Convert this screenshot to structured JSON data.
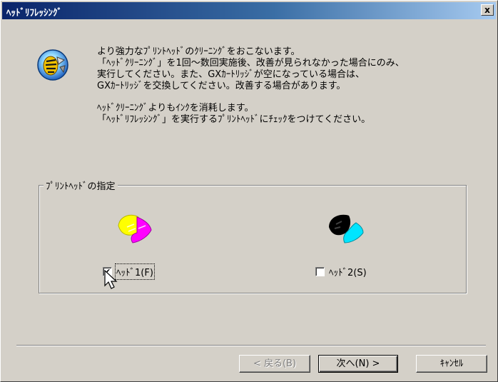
{
  "window": {
    "title": "ﾍｯﾄﾞﾘﾌﾚｯｼﾝｸﾞ",
    "close_glyph": "x",
    "icon": "printer-head-cleaning-icon"
  },
  "message": {
    "line1": "より強力なﾌﾟﾘﾝﾄﾍｯﾄﾞのｸﾘｰﾆﾝｸﾞをおこないます。",
    "line2": "「ﾍｯﾄﾞｸﾘｰﾆﾝｸﾞ」を1回～数回実施後、改善が見られなかった場合にのみ、",
    "line3": "実行してください。また、GXｶｰﾄﾘｯｼﾞが空になっている場合は、",
    "line4": "GXｶｰﾄﾘｯｼﾞを交換してください。改善する場合があります。",
    "line5": "ﾍｯﾄﾞｸﾘｰﾆﾝｸﾞよりもｲﾝｸを消耗します。",
    "line6": "「ﾍｯﾄﾞﾘﾌﾚｯｼﾝｸﾞ」を実行するﾌﾟﾘﾝﾄﾍｯﾄﾞにﾁｪｯｸをつけてください。"
  },
  "printhead_group": {
    "label": "ﾌﾟﾘﾝﾄﾍｯﾄﾞの指定",
    "heads": [
      {
        "label": "ﾍｯﾄﾞ1(F)",
        "checked": true,
        "colors": [
          "#ffff00",
          "#ff00ff",
          "#00e5ff"
        ]
      },
      {
        "label": "ﾍｯﾄﾞ2(S)",
        "checked": false,
        "colors": [
          "#000000",
          "#00e5ff"
        ]
      }
    ]
  },
  "buttons": {
    "back": "< 戻る(B)",
    "next": "次へ(N) >",
    "cancel": "ｷｬﾝｾﾙ"
  },
  "colors": {
    "dialog_bg": "#d4d0c8",
    "titlebar_start": "#0a246a",
    "titlebar_end": "#a6caf0"
  }
}
